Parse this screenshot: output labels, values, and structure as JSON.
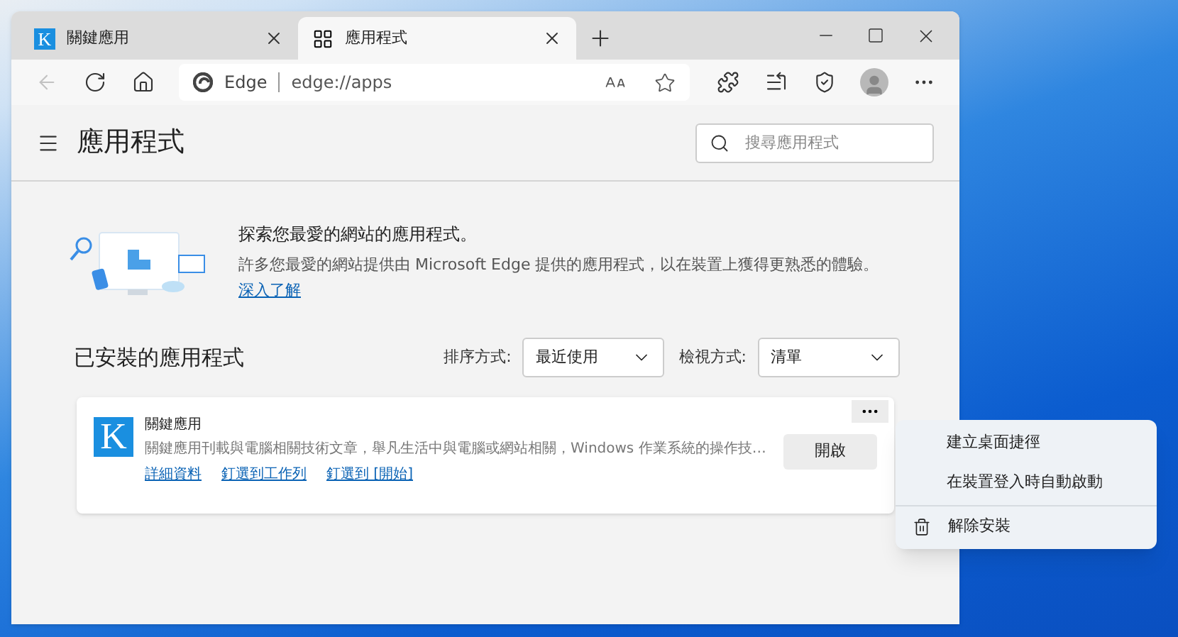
{
  "tabs": [
    {
      "label": "關鍵應用",
      "kind": "logo",
      "logo": "K",
      "selected": false
    },
    {
      "label": "應用程式",
      "kind": "apps",
      "selected": true
    }
  ],
  "address_bar": {
    "site_label": "Edge",
    "url": "edge://apps"
  },
  "page": {
    "title": "應用程式",
    "search": {
      "placeholder": "搜尋應用程式"
    }
  },
  "banner": {
    "heading": "探索您最愛的網站的應用程式。",
    "text": "許多您最愛的網站提供由 Microsoft Edge 提供的應用程式，以在裝置上獲得更熟悉的體驗。",
    "link": "深入了解"
  },
  "installed": {
    "heading": "已安裝的應用程式",
    "sort": {
      "label": "排序方式:",
      "value": "最近使用"
    },
    "view": {
      "label": "檢視方式:",
      "value": "清單"
    }
  },
  "apps": [
    {
      "logo": "K",
      "name": "關鍵應用",
      "description": "關鍵應用刊載與電腦相關技術文章，舉凡生活中與電腦或網站相關，Windows 作業系統的操作技…",
      "links": [
        "詳細資料",
        "釘選到工作列",
        "釘選到 [開始]"
      ],
      "open_button": "開啟"
    }
  ],
  "context_menu": [
    {
      "label": "建立桌面捷徑",
      "kind": "plain"
    },
    {
      "label": "在裝置登入時自動啟動",
      "kind": "plain"
    },
    {
      "label": "解除安裝",
      "kind": "trash"
    }
  ]
}
